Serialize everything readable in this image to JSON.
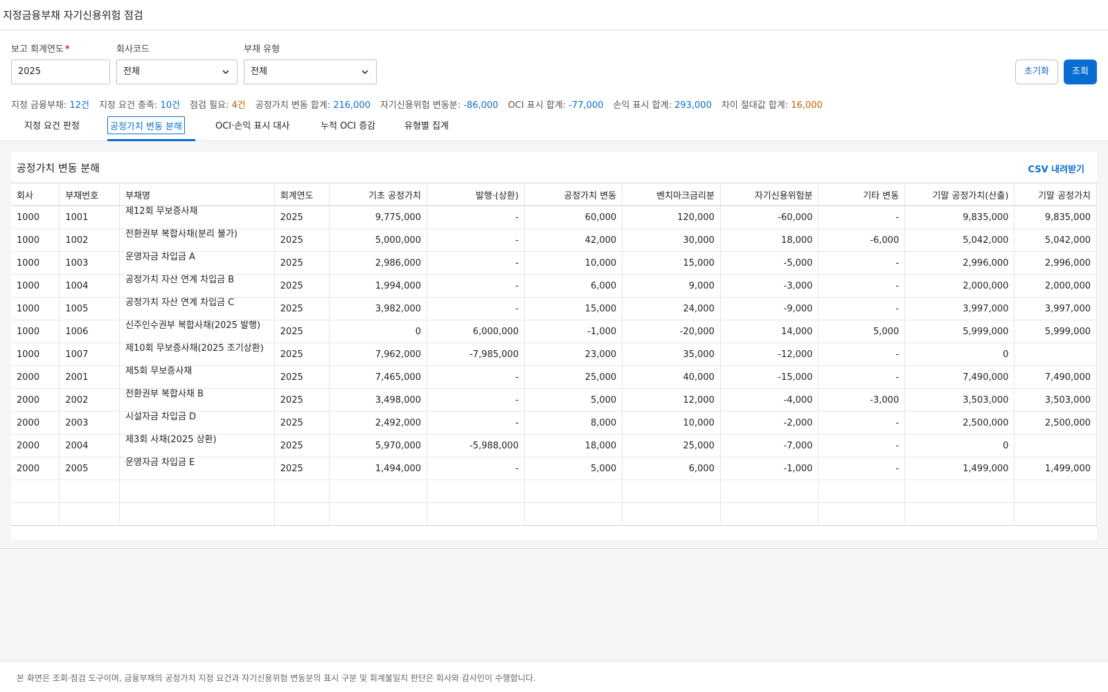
{
  "page": {
    "title": "지정금융부채 자기신용위험 점검"
  },
  "filters": {
    "year_label": "보고 회계연도",
    "year_required": "*",
    "year_value": "2025",
    "company_label": "회사코드",
    "company_value": "전체",
    "type_label": "부채 유형",
    "type_value": "전체"
  },
  "buttons": {
    "reset": "초기화",
    "search": "조회"
  },
  "summary": [
    {
      "label": "지정 금융부채:",
      "value": "12건",
      "tone": "blue"
    },
    {
      "label": "지정 요건 충족:",
      "value": "10건",
      "tone": "blue"
    },
    {
      "label": "점검 필요:",
      "value": "4건",
      "tone": "orange"
    },
    {
      "label": "공정가치 변동 합계:",
      "value": "216,000",
      "tone": "blue"
    },
    {
      "label": "자기신용위험 변동분:",
      "value": "-86,000",
      "tone": "blue"
    },
    {
      "label": "OCI 표시 합계:",
      "value": "-77,000",
      "tone": "blue"
    },
    {
      "label": "손익 표시 합계:",
      "value": "293,000",
      "tone": "blue"
    },
    {
      "label": "차이 절대값 합계:",
      "value": "16,000",
      "tone": "orange"
    }
  ],
  "tabs": [
    {
      "label": "지정 요건 판정"
    },
    {
      "label": "공정가치 변동 분해"
    },
    {
      "label": "OCI·손익 표시 대사"
    },
    {
      "label": "누적 OCI 증감"
    },
    {
      "label": "유형별 집계"
    }
  ],
  "panel": {
    "title": "공정가치 변동 분해",
    "csv_label": "CSV 내려받기"
  },
  "table": {
    "columns": [
      "회사",
      "부채번호",
      "부채명",
      "회계연도",
      "기초 공정가치",
      "발행·(상환)",
      "공정가치 변동",
      "벤치마크금리분",
      "자기신용위험분",
      "기타 변동",
      "기말 공정가치(산출)",
      "기말 공정가치"
    ],
    "rows": [
      [
        "1000",
        "1001",
        "제12회 무보증사채",
        "2025",
        "9,775,000",
        "-",
        "60,000",
        "120,000",
        "-60,000",
        "-",
        "9,835,000",
        "9,835,000"
      ],
      [
        "1000",
        "1002",
        "전환권부 복합사채(분리 불가)",
        "2025",
        "5,000,000",
        "-",
        "42,000",
        "30,000",
        "18,000",
        "-6,000",
        "5,042,000",
        "5,042,000"
      ],
      [
        "1000",
        "1003",
        "운영자금 차입금 A",
        "2025",
        "2,986,000",
        "-",
        "10,000",
        "15,000",
        "-5,000",
        "-",
        "2,996,000",
        "2,996,000"
      ],
      [
        "1000",
        "1004",
        "공정가치 자산 연계 차입금 B",
        "2025",
        "1,994,000",
        "-",
        "6,000",
        "9,000",
        "-3,000",
        "-",
        "2,000,000",
        "2,000,000"
      ],
      [
        "1000",
        "1005",
        "공정가치 자산 연계 차입금 C",
        "2025",
        "3,982,000",
        "-",
        "15,000",
        "24,000",
        "-9,000",
        "-",
        "3,997,000",
        "3,997,000"
      ],
      [
        "1000",
        "1006",
        "신주인수권부 복합사채(2025 발행)",
        "2025",
        "0",
        "6,000,000",
        "-1,000",
        "-20,000",
        "14,000",
        "5,000",
        "5,999,000",
        "5,999,000"
      ],
      [
        "1000",
        "1007",
        "제10회 무보증사채(2025 조기상환)",
        "2025",
        "7,962,000",
        "-7,985,000",
        "23,000",
        "35,000",
        "-12,000",
        "-",
        "0",
        ""
      ],
      [
        "2000",
        "2001",
        "제5회 무보증사채",
        "2025",
        "7,465,000",
        "-",
        "25,000",
        "40,000",
        "-15,000",
        "-",
        "7,490,000",
        "7,490,000"
      ],
      [
        "2000",
        "2002",
        "전환권부 복합사채 B",
        "2025",
        "3,498,000",
        "-",
        "5,000",
        "12,000",
        "-4,000",
        "-3,000",
        "3,503,000",
        "3,503,000"
      ],
      [
        "2000",
        "2003",
        "시설자금 차입금 D",
        "2025",
        "2,492,000",
        "-",
        "8,000",
        "10,000",
        "-2,000",
        "-",
        "2,500,000",
        "2,500,000"
      ],
      [
        "2000",
        "2004",
        "제3회 사채(2025 상환)",
        "2025",
        "5,970,000",
        "-5,988,000",
        "18,000",
        "25,000",
        "-7,000",
        "-",
        "0",
        ""
      ],
      [
        "2000",
        "2005",
        "운영자금 차입금 E",
        "2025",
        "1,494,000",
        "-",
        "5,000",
        "6,000",
        "-1,000",
        "-",
        "1,499,000",
        "1,499,000"
      ],
      [
        "",
        "",
        "",
        "",
        "",
        "",
        "",
        "",
        "",
        "",
        "",
        ""
      ],
      [
        "",
        "",
        "",
        "",
        "",
        "",
        "",
        "",
        "",
        "",
        "",
        ""
      ]
    ]
  },
  "footer": {
    "note": "본 화면은 조회·점검 도구이며, 금융부채의 공정가치 지정 요건과 자기신용위험 변동분의 표시 구분 및 회계불일치 판단은 회사와 감사인이 수행합니다."
  }
}
